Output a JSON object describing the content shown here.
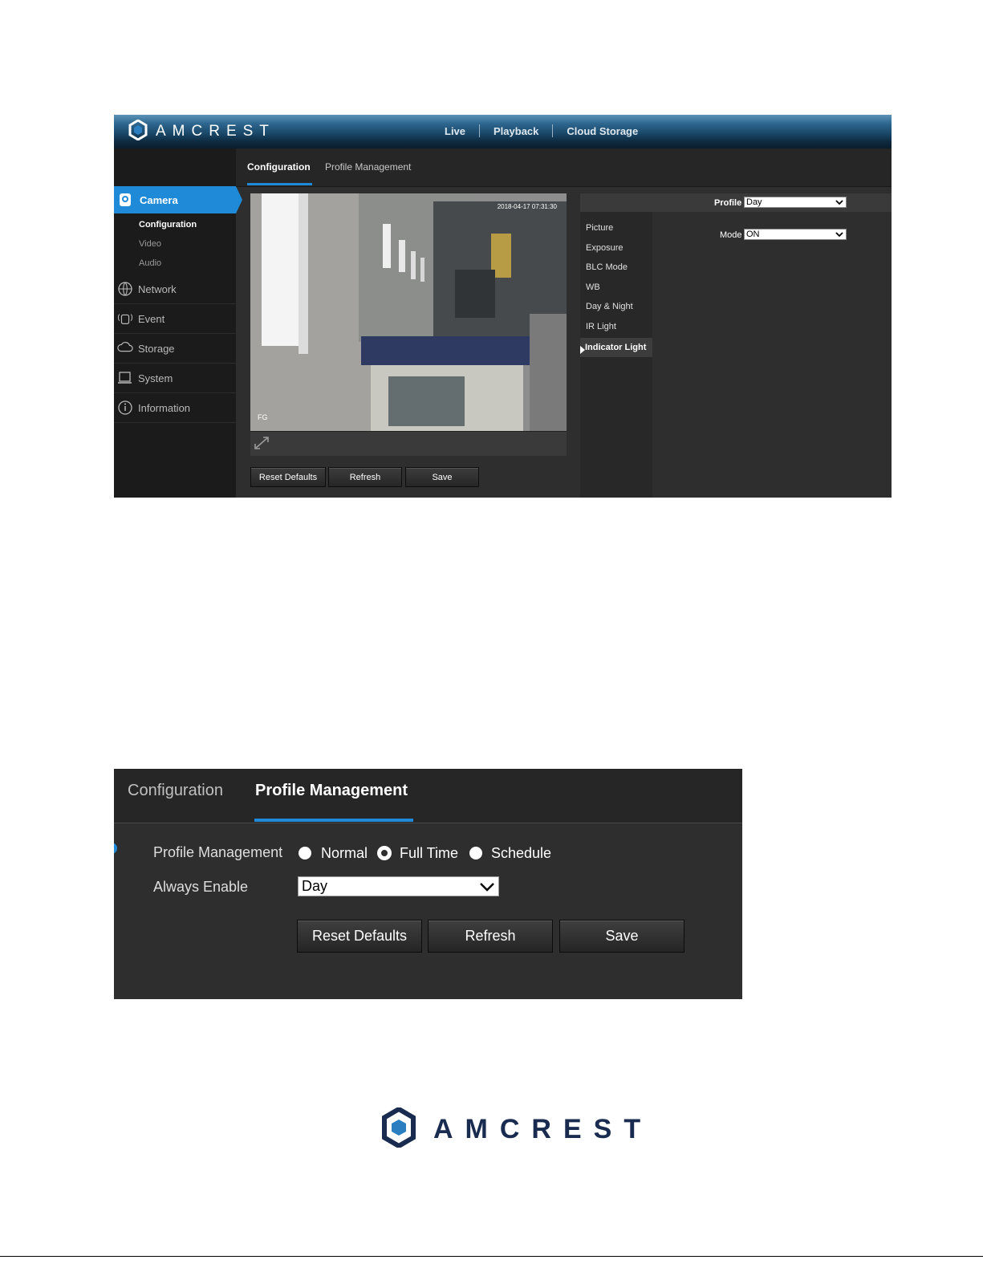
{
  "brand": {
    "name": "AMCREST"
  },
  "topnav": {
    "items": [
      "Live",
      "Playback",
      "Cloud Storage"
    ]
  },
  "sidebar": {
    "active": "Camera",
    "sub_items": [
      "Configuration",
      "Video",
      "Audio"
    ],
    "items": [
      "Network",
      "Event",
      "Storage",
      "System",
      "Information"
    ]
  },
  "tabs1": {
    "items": [
      "Configuration",
      "Profile Management"
    ]
  },
  "video": {
    "timestamp": "2018-04-17 07:31:30",
    "corner_label": "FG"
  },
  "buttons1": {
    "reset": "Reset Defaults",
    "refresh": "Refresh",
    "save": "Save"
  },
  "settings": {
    "profile_label": "Profile",
    "profile_value": "Day",
    "mode_label": "Mode",
    "mode_value": "ON",
    "submenu": [
      "Picture",
      "Exposure",
      "BLC Mode",
      "WB",
      "Day & Night",
      "IR Light"
    ],
    "submenu_active": "Indicator Light"
  },
  "panel2": {
    "tabs": [
      "Configuration",
      "Profile Management"
    ],
    "profile_mgmt_label": "Profile Management",
    "radios": [
      "Normal",
      "Full Time",
      "Schedule"
    ],
    "radio_selected": "Full Time",
    "always_enable_label": "Always Enable",
    "always_enable_value": "Day",
    "buttons": {
      "reset": "Reset Defaults",
      "refresh": "Refresh",
      "save": "Save"
    }
  },
  "colors": {
    "accent": "#1f8ad8",
    "panel": "#2e2e2e",
    "sidebar": "#1b1b1b",
    "brand_navy": "#1a2b50"
  },
  "icons": [
    "amcrest-logo-icon",
    "camera-icon",
    "network-icon",
    "event-icon",
    "storage-icon",
    "system-icon",
    "information-icon",
    "fullscreen-icon",
    "chevron-down-icon"
  ]
}
